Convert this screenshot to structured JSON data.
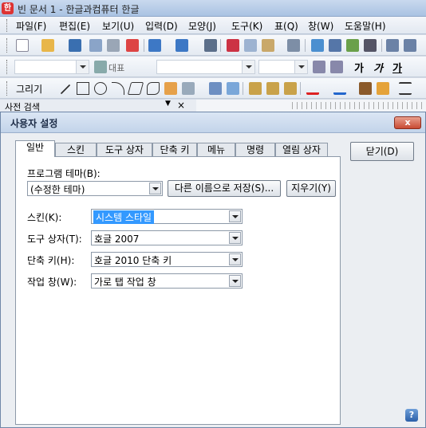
{
  "window": {
    "title": "빈 문서 1 - 한글과컴퓨터 한글",
    "app_icon": "한"
  },
  "menu": [
    "파일(F)",
    "편집(E)",
    "보기(U)",
    "입력(D)",
    "모양(J)",
    "도구(K)",
    "표(Q)",
    "창(W)",
    "도움말(H)"
  ],
  "toolbar2": {
    "style_label": "대표"
  },
  "toolbar3": {
    "draw_label": "그리기",
    "text_bold": "가",
    "text_italic": "가",
    "text_under": "가"
  },
  "sidebar": {
    "title": "사전 검색"
  },
  "dialog": {
    "title": "사용자 설정",
    "close": "x",
    "tabs": [
      "일반",
      "스킨",
      "도구 상자",
      "단축 키",
      "메뉴",
      "명령",
      "열림 상자"
    ],
    "active_tab": "일반",
    "close_button": "닫기(D)",
    "help": "?",
    "theme": {
      "label": "프로그램 테마(B):",
      "value": "(수정한 테마)",
      "save_as": "다른 이름으로 저장(S)...",
      "delete": "지우기(Y)"
    },
    "fields": [
      {
        "label": "스킨(K):",
        "value": "시스템 스타일"
      },
      {
        "label": "도구 상자(T):",
        "value": "호글 2007"
      },
      {
        "label": "단축 키(H):",
        "value": "호글 2010 단축 키"
      },
      {
        "label": "작업 창(W):",
        "value": "가로 탭 작업 창"
      }
    ]
  }
}
